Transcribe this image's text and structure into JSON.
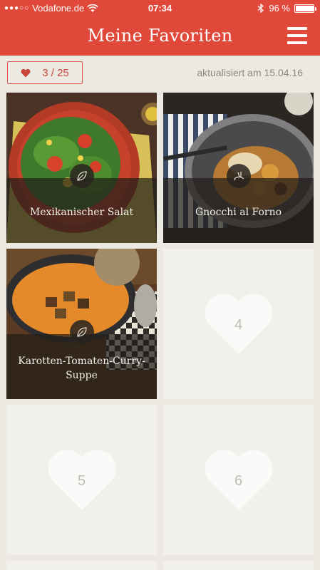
{
  "status_bar": {
    "carrier": "Vodafone.de",
    "time": "07:34",
    "battery": "96 %",
    "battery_level": 0.96,
    "signal_icon": "signal-dots-icon",
    "wifi_icon": "wifi-icon",
    "bluetooth_icon": "bluetooth-icon"
  },
  "header": {
    "title": "Meine Favoriten",
    "menu_icon": "hamburger-menu-icon"
  },
  "toolbar": {
    "counter": "3 / 25",
    "counter_icon": "heart-icon",
    "updated": "aktualisiert am 15.04.16"
  },
  "favorites": [
    {
      "label": "Mexikanischer Salat",
      "category_icon": "leaf-icon"
    },
    {
      "label": "Gnocchi al Forno",
      "category_icon": "rabbit-icon"
    },
    {
      "label": "Karotten-Tomaten-Curry-Suppe",
      "category_icon": "leaf-icon"
    }
  ],
  "empty_slots": [
    "4",
    "5",
    "6"
  ],
  "colors": {
    "brand": "#e0483a",
    "background": "#ece9e2",
    "slot": "#f2f0eb"
  }
}
